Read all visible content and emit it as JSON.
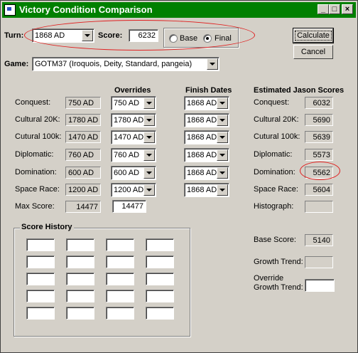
{
  "window": {
    "title": "Victory Condition Comparison"
  },
  "turn": {
    "label": "Turn:",
    "value": "1868 AD"
  },
  "score": {
    "label": "Score:",
    "value": "6232"
  },
  "mode": {
    "base_label": "Base",
    "final_label": "Final",
    "selected": "Final"
  },
  "buttons": {
    "calculate": "Calculate",
    "cancel": "Cancel"
  },
  "game": {
    "label": "Game:",
    "value": "GOTM37 (Iroquois, Deity, Standard, pangeia)"
  },
  "headers": {
    "overrides": "Overrides",
    "finish_dates": "Finish Dates",
    "estimated": "Estimated Jason Scores"
  },
  "conditions": [
    {
      "label": "Conquest:",
      "date": "750 AD",
      "override": "750 AD",
      "finish": "1868 AD",
      "est_label": "Conquest:",
      "est": "6032"
    },
    {
      "label": "Cultural 20K:",
      "date": "1780 AD",
      "override": "1780 AD",
      "finish": "1868 AD",
      "est_label": "Cultural 20K:",
      "est": "5690"
    },
    {
      "label": "Cutural 100k:",
      "date": "1470 AD",
      "override": "1470 AD",
      "finish": "1868 AD",
      "est_label": "Cutural 100k:",
      "est": "5639"
    },
    {
      "label": "Diplomatic:",
      "date": "760 AD",
      "override": "760 AD",
      "finish": "1868 AD",
      "est_label": "Diplomatic:",
      "est": "5573"
    },
    {
      "label": "Domination:",
      "date": "600 AD",
      "override": "600 AD",
      "finish": "1868 AD",
      "est_label": "Domination:",
      "est": "5562"
    },
    {
      "label": "Space Race:",
      "date": "1200 AD",
      "override": "1200 AD",
      "finish": "1868 AD",
      "est_label": "Space Race:",
      "est": "5604"
    }
  ],
  "max_score": {
    "label": "Max Score:",
    "value": "14477",
    "override": "14477"
  },
  "histograph": {
    "label": "Histograph:"
  },
  "score_history": {
    "title": "Score History"
  },
  "base_score": {
    "label": "Base Score:",
    "value": "5140"
  },
  "growth_trend": {
    "label": "Growth Trend:"
  },
  "override_growth": {
    "label_line1": "Override",
    "label_line2": "Growth Trend:"
  },
  "colors": {
    "titlebar": "#008000",
    "face": "#d4d0c8",
    "highlight_ellipse": "#e02020"
  }
}
